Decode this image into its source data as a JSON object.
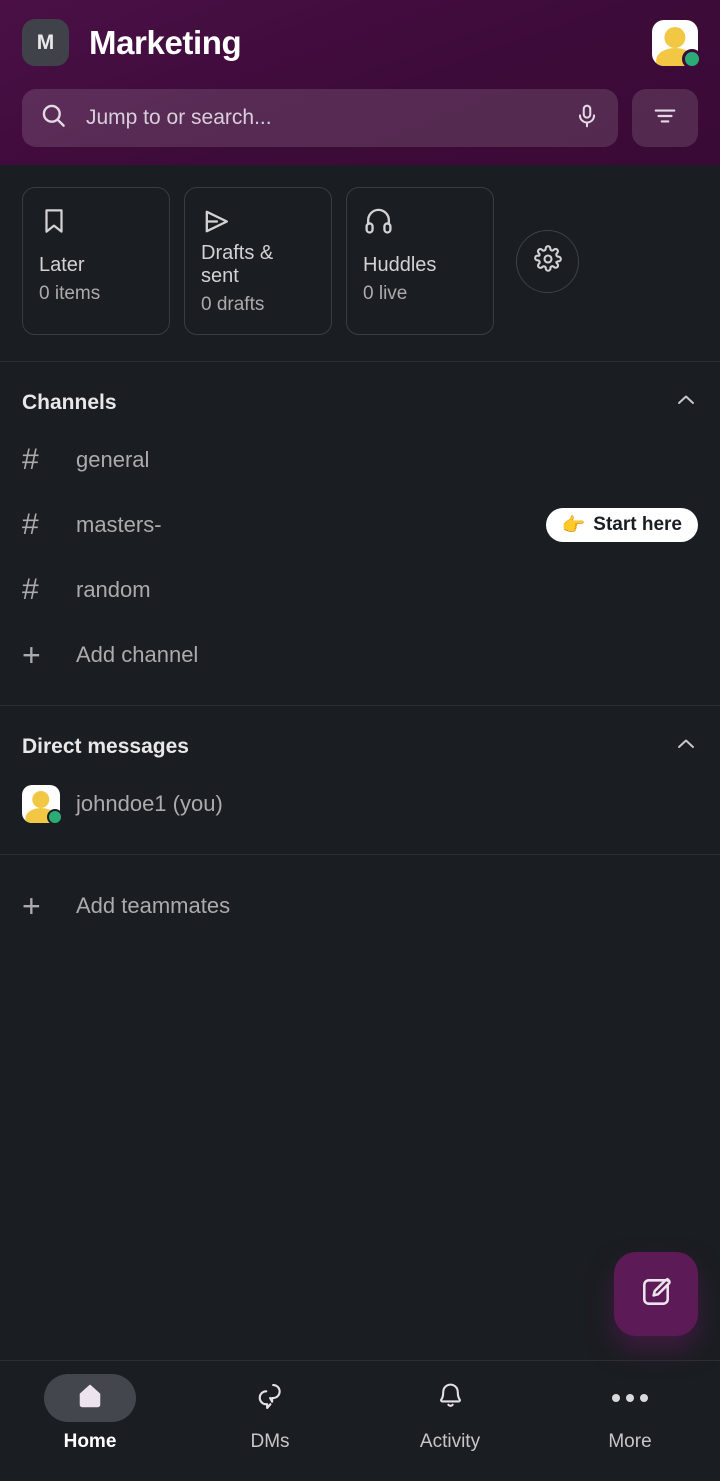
{
  "header": {
    "workspace_initial": "M",
    "workspace_title": "Marketing",
    "avatar_name": "user-avatar",
    "search": {
      "placeholder": "Jump to or search...",
      "mic_icon": "microphone-icon",
      "search_icon": "search-icon"
    },
    "filter_icon": "filter-icon",
    "accent_purple": "#4A1046",
    "presence_color": "#2BAC76"
  },
  "quick_actions": {
    "cards": [
      {
        "icon": "bookmark-icon",
        "title": "Later",
        "subtitle": "0 items"
      },
      {
        "icon": "paper-plane-icon",
        "title": "Drafts & sent",
        "subtitle": "0 drafts"
      },
      {
        "icon": "headphones-icon",
        "title": "Huddles",
        "subtitle": "0 live"
      }
    ],
    "settings_icon": "gear-icon"
  },
  "channels_section": {
    "title": "Channels",
    "collapse_icon": "chevron-up-icon",
    "items": [
      {
        "icon": "hash-icon",
        "label": "general",
        "badge": null
      },
      {
        "icon": "hash-icon",
        "label": "masters-",
        "badge": {
          "emoji": "👉",
          "text": "Start here"
        }
      },
      {
        "icon": "hash-icon",
        "label": "random",
        "badge": null
      },
      {
        "icon": "plus-icon",
        "label": "Add channel",
        "badge": null
      }
    ]
  },
  "dms_section": {
    "title": "Direct messages",
    "collapse_icon": "chevron-up-icon",
    "items": [
      {
        "icon": "user-avatar",
        "label": "johndoe1 (you)"
      }
    ],
    "add_teammates": {
      "icon": "plus-icon",
      "label": "Add teammates"
    }
  },
  "compose": {
    "icon": "compose-icon",
    "color": "#5C1A57"
  },
  "bottom_nav": {
    "items": [
      {
        "icon": "home-icon",
        "label": "Home",
        "active": true
      },
      {
        "icon": "dms-icon",
        "label": "DMs",
        "active": false
      },
      {
        "icon": "bell-icon",
        "label": "Activity",
        "active": false
      },
      {
        "icon": "more-icon",
        "label": "More",
        "active": false
      }
    ]
  }
}
